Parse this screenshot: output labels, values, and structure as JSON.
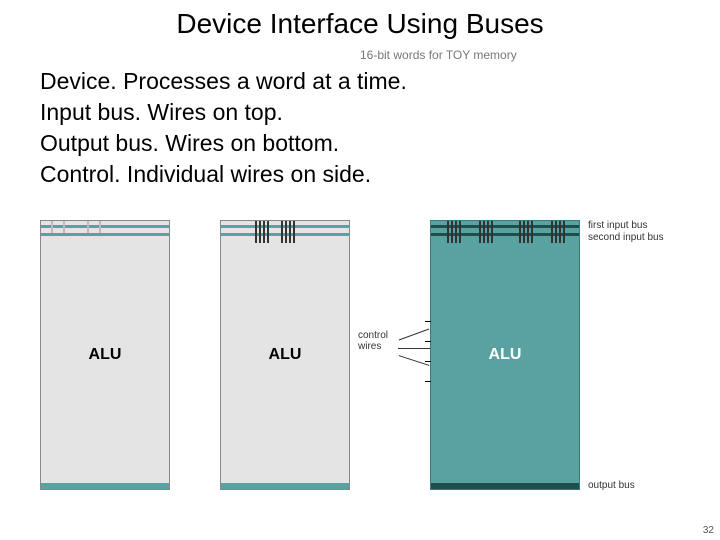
{
  "title": "Device Interface Using Buses",
  "note": "16-bit words for TOY memory",
  "lines": [
    "Device.  Processes a word at a time.",
    "Input bus.  Wires on top.",
    "Output bus.  Wires on bottom.",
    "Control.   Individual wires on side."
  ],
  "module_label": "ALU",
  "labels": {
    "first_input_bus": "first input bus",
    "second_input_bus": "second input bus",
    "control_wires": "control\nwires",
    "output_bus": "output bus"
  },
  "page_number": "32"
}
